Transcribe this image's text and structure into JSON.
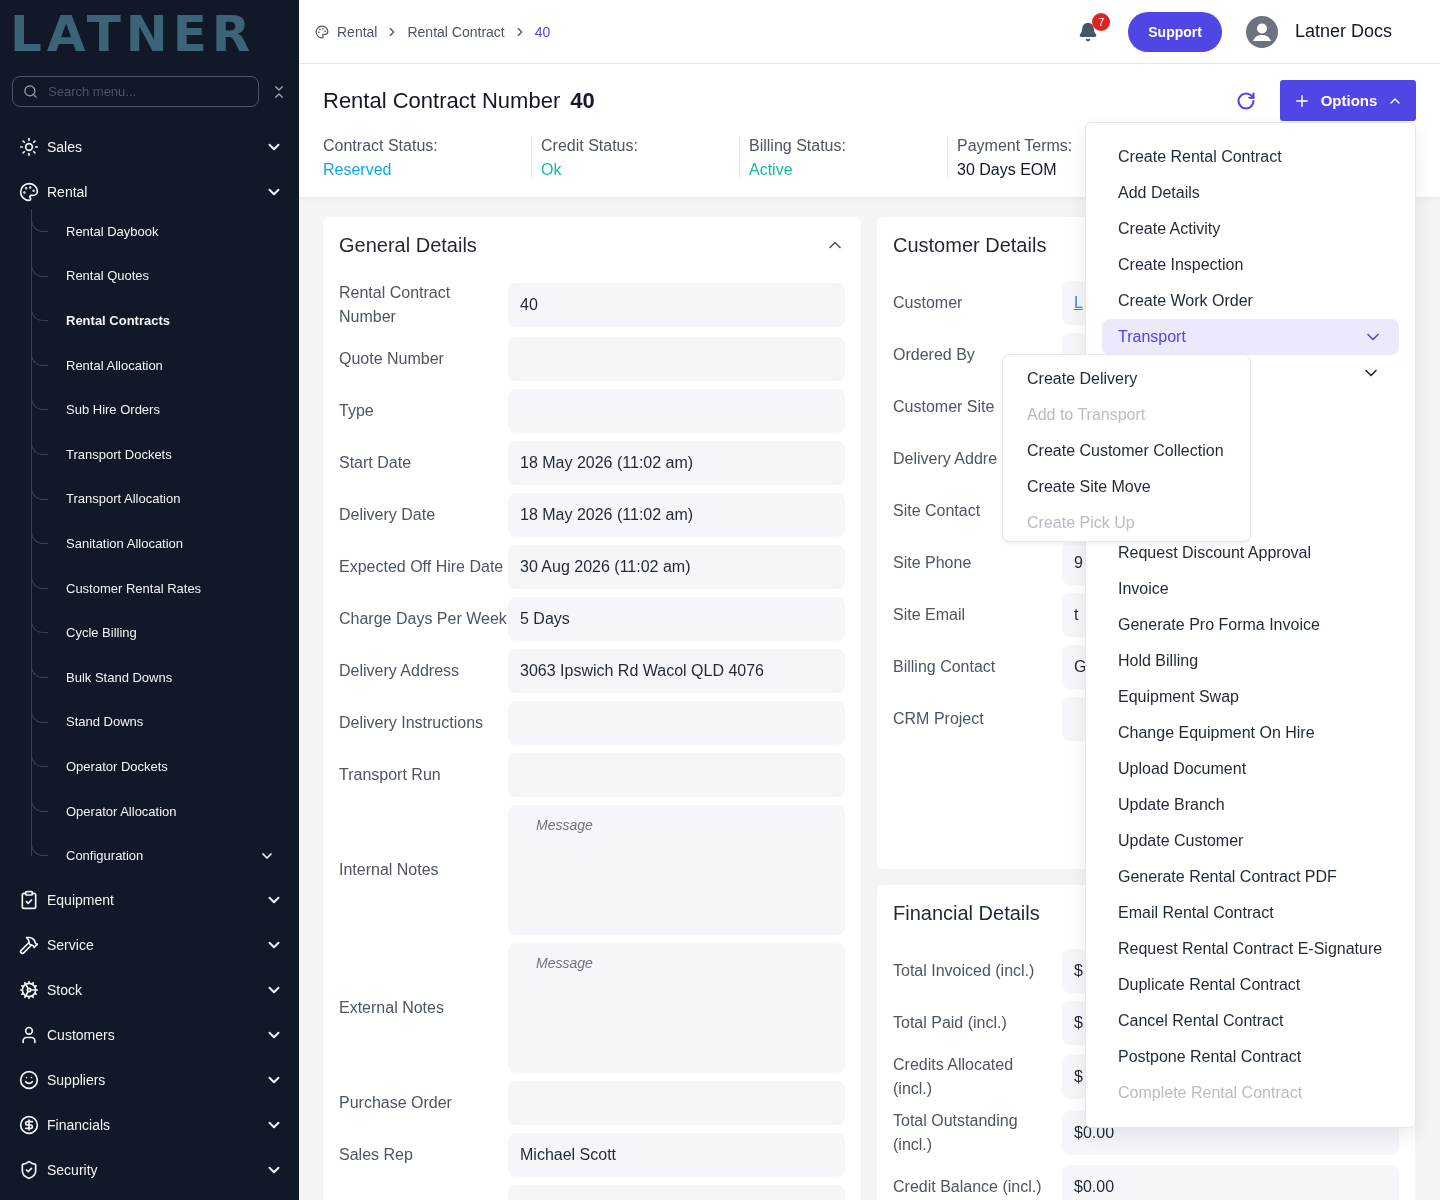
{
  "sidebar": {
    "logo": "LATNER",
    "search": {
      "placeholder": "Search menu..."
    },
    "items": [
      {
        "label": "Sales"
      },
      {
        "label": "Rental",
        "expanded": true,
        "children": [
          {
            "label": "Rental Daybook",
            "selected": false,
            "kind": "link"
          },
          {
            "label": "Rental Quotes",
            "selected": false,
            "kind": "link"
          },
          {
            "label": "Rental Contracts",
            "selected": true,
            "kind": "link"
          },
          {
            "label": "Rental Allocation",
            "selected": false,
            "kind": "link"
          },
          {
            "label": "Sub Hire Orders",
            "selected": false,
            "kind": "link"
          },
          {
            "label": "Transport Dockets",
            "selected": false,
            "kind": "link"
          },
          {
            "label": "Transport Allocation",
            "selected": false,
            "kind": "link"
          },
          {
            "label": "Sanitation Allocation",
            "selected": false,
            "kind": "link"
          },
          {
            "label": "Customer Rental Rates",
            "selected": false,
            "kind": "link"
          },
          {
            "label": "Cycle Billing",
            "selected": false,
            "kind": "link"
          },
          {
            "label": "Bulk Stand Downs",
            "selected": false,
            "kind": "link"
          },
          {
            "label": "Stand Downs",
            "selected": false,
            "kind": "link"
          },
          {
            "label": "Operator Dockets",
            "selected": false,
            "kind": "link"
          },
          {
            "label": "Operator Allocation",
            "selected": false,
            "kind": "link"
          },
          {
            "label": "Configuration",
            "selected": false,
            "kind": "group"
          }
        ]
      },
      {
        "label": "Equipment"
      },
      {
        "label": "Service"
      },
      {
        "label": "Stock"
      },
      {
        "label": "Customers"
      },
      {
        "label": "Suppliers"
      },
      {
        "label": "Financials"
      },
      {
        "label": "Security"
      }
    ]
  },
  "topbar": {
    "breadcrumbs": [
      {
        "label": "Rental",
        "selected": false
      },
      {
        "label": "Rental Contract",
        "selected": false
      },
      {
        "label": "40",
        "selected": true
      }
    ],
    "notification_count": "7",
    "support_button": "Support",
    "user_name": "Latner Docs"
  },
  "header": {
    "title": "Rental Contract Number",
    "number": "40",
    "options_button": {
      "label": "Options",
      "expanded": true
    },
    "statuses": [
      {
        "label": "Contract Status:",
        "value": "Reserved",
        "color": "#0ea5e9"
      },
      {
        "label": "Credit Status:",
        "value": "Ok",
        "color": "#14b8a6"
      },
      {
        "label": "Billing Status:",
        "value": "Active",
        "color": "#14b8a6"
      },
      {
        "label": "Payment Terms:",
        "value": "30 Days EOM",
        "color": "#111827"
      }
    ]
  },
  "general_details": {
    "title": "General Details",
    "expanded": true,
    "fields": [
      {
        "label": "Rental Contract Number",
        "value": "40",
        "kind": "input"
      },
      {
        "label": "Quote Number",
        "kind": "input"
      },
      {
        "label": "Type",
        "kind": "input"
      },
      {
        "label": "Start Date",
        "value": "18 May 2026 (11:02 am)",
        "kind": "input"
      },
      {
        "label": "Delivery Date",
        "value": "18 May 2026 (11:02 am)",
        "kind": "input"
      },
      {
        "label": "Expected Off Hire Date",
        "value": "30 Aug 2026 (11:02 am)",
        "kind": "input"
      },
      {
        "label": "Charge Days Per Week",
        "value": "5 Days",
        "kind": "input"
      },
      {
        "label": "Delivery Address",
        "value": "3063 Ipswich Rd Wacol QLD 4076",
        "kind": "input"
      },
      {
        "label": "Delivery Instructions",
        "kind": "input"
      },
      {
        "label": "Transport Run",
        "kind": "input"
      },
      {
        "label": "Internal Notes",
        "placeholder": "Message",
        "kind": "textarea"
      },
      {
        "label": "External Notes",
        "placeholder": "Message",
        "kind": "textarea"
      },
      {
        "label": "Purchase Order",
        "kind": "input"
      },
      {
        "label": "Sales Rep",
        "value": "Michael Scott",
        "kind": "input"
      },
      {
        "kind": "input"
      }
    ]
  },
  "customer_details": {
    "title": "Customer Details",
    "fields": [
      {
        "label": "Customer",
        "value": "L",
        "kind": "link"
      },
      {
        "label": "Ordered By",
        "kind": "input"
      },
      {
        "label": "Customer Site",
        "kind": "input"
      },
      {
        "label": "Delivery Addre",
        "kind": "input"
      },
      {
        "label": "Site Contact",
        "kind": "input"
      },
      {
        "label": "Site Phone",
        "value": "9",
        "kind": "input"
      },
      {
        "label": "Site Email",
        "value": "t",
        "kind": "input"
      },
      {
        "label": "Billing Contact",
        "value": "G",
        "kind": "input"
      },
      {
        "label": "CRM Project",
        "kind": "input"
      }
    ]
  },
  "financial_details": {
    "title": "Financial Details",
    "fields": [
      {
        "label": "Total Invoiced (incl.)",
        "value": "$",
        "kind": "input"
      },
      {
        "label": "Total Paid (incl.)",
        "value": "$",
        "kind": "input"
      },
      {
        "label": "Credits Allocated (incl.)",
        "value": "$",
        "kind": "input"
      },
      {
        "label": "Total Outstanding (incl.)",
        "value": "$0.00",
        "kind": "input"
      },
      {
        "label": "Credit Balance (incl.)",
        "value": "$0.00",
        "kind": "input"
      }
    ]
  },
  "options_menu": {
    "items": [
      {
        "label": "Create Rental Contract",
        "kind": "action",
        "disabled": false
      },
      {
        "label": "Add Details",
        "kind": "action",
        "disabled": false
      },
      {
        "label": "Create Activity",
        "kind": "action",
        "disabled": false
      },
      {
        "label": "Create Inspection",
        "kind": "action",
        "disabled": false
      },
      {
        "label": "Create Work Order",
        "kind": "action",
        "disabled": false
      },
      {
        "label": "Transport",
        "kind": "group",
        "selected": true,
        "expanded": true,
        "children": [
          {
            "label": "Create Delivery",
            "disabled": false
          },
          {
            "label": "Add to Transport",
            "disabled": true
          },
          {
            "label": "Create Customer Collection",
            "disabled": false
          },
          {
            "label": "Create Site Move",
            "disabled": false
          },
          {
            "label": "Create Pick Up",
            "disabled": true
          }
        ]
      },
      {
        "kind": "covered_group"
      },
      {
        "kind": "covered"
      },
      {
        "kind": "covered"
      },
      {
        "kind": "covered"
      },
      {
        "kind": "covered"
      },
      {
        "label": "Request Discount Approval",
        "kind": "action",
        "disabled": false
      },
      {
        "label": "Invoice",
        "kind": "action",
        "disabled": false
      },
      {
        "label": "Generate Pro Forma Invoice",
        "kind": "action",
        "disabled": false
      },
      {
        "label": "Hold Billing",
        "kind": "action",
        "disabled": false
      },
      {
        "label": "Equipment Swap",
        "kind": "action",
        "disabled": false
      },
      {
        "label": "Change Equipment On Hire",
        "kind": "action",
        "disabled": false
      },
      {
        "label": "Upload Document",
        "kind": "action",
        "disabled": false
      },
      {
        "label": "Update Branch",
        "kind": "action",
        "disabled": false
      },
      {
        "label": "Update Customer",
        "kind": "action",
        "disabled": false
      },
      {
        "label": "Generate Rental Contract PDF",
        "kind": "action",
        "disabled": false
      },
      {
        "label": "Email Rental Contract",
        "kind": "action",
        "disabled": false
      },
      {
        "label": "Request Rental Contract E-Signature",
        "kind": "action",
        "disabled": false
      },
      {
        "label": "Duplicate Rental Contract",
        "kind": "action",
        "disabled": false
      },
      {
        "label": "Cancel Rental Contract",
        "kind": "action",
        "disabled": false
      },
      {
        "label": "Postpone Rental Contract",
        "kind": "action",
        "disabled": false
      },
      {
        "label": "Complete Rental Contract",
        "kind": "action",
        "disabled": true
      }
    ]
  }
}
